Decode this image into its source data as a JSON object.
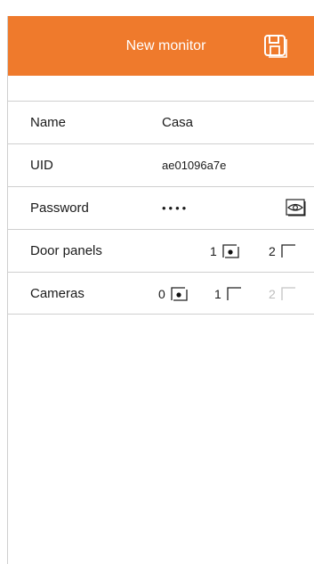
{
  "header": {
    "title": "New monitor",
    "background_color": "#ef7a2c",
    "save_icon": "save-icon"
  },
  "form": {
    "name": {
      "label": "Name",
      "value": "Casa"
    },
    "uid": {
      "label": "UID",
      "value": "ae01096a7e"
    },
    "password": {
      "label": "Password",
      "masked_value": "••••",
      "reveal_icon": "eye-icon"
    },
    "door_panels": {
      "label": "Door panels",
      "options": [
        {
          "value": "1",
          "selected": true,
          "enabled": true
        },
        {
          "value": "2",
          "selected": false,
          "enabled": true
        }
      ]
    },
    "cameras": {
      "label": "Cameras",
      "options": [
        {
          "value": "0",
          "selected": true,
          "enabled": true
        },
        {
          "value": "1",
          "selected": false,
          "enabled": true
        },
        {
          "value": "2",
          "selected": false,
          "enabled": false
        }
      ]
    }
  }
}
